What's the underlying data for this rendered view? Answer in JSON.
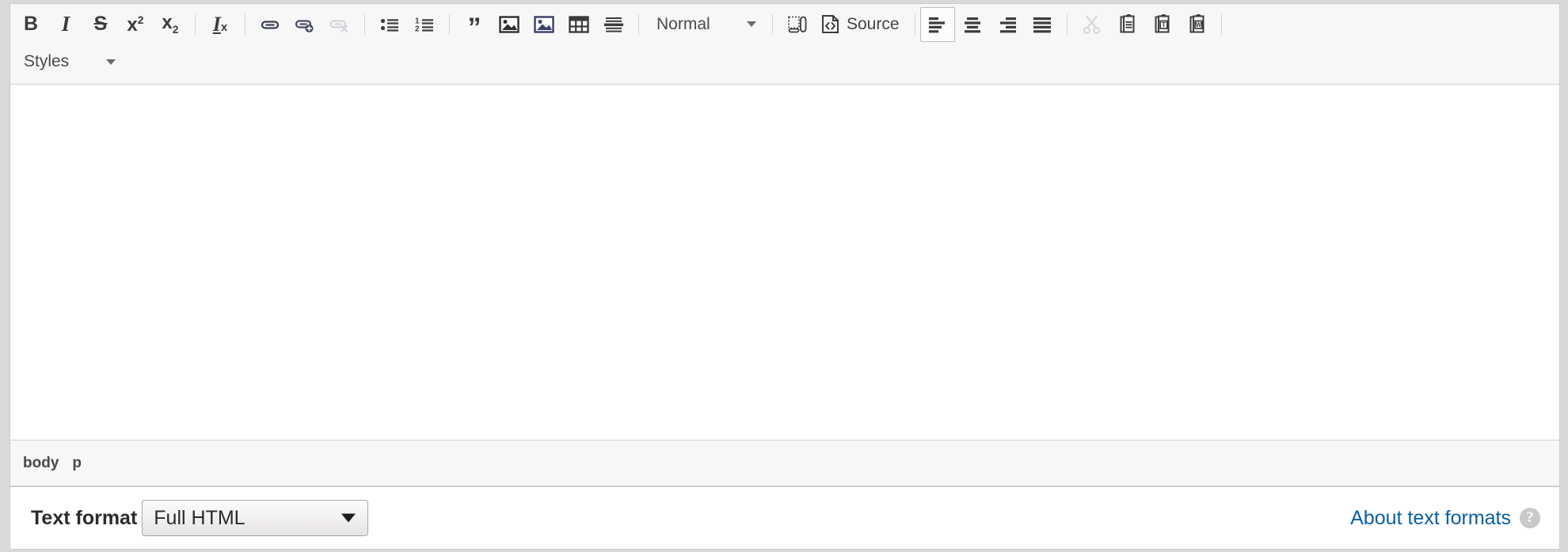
{
  "editor": {
    "name": "ckeditor-rich-text-editor",
    "toolbar": {
      "rows": [
        {
          "groups": [
            {
              "name": "basicstyles",
              "buttons": [
                {
                  "name": "bold-button",
                  "label": "B",
                  "icon": "bold-icon",
                  "title": "Bold",
                  "state": "normal"
                },
                {
                  "name": "italic-button",
                  "label": "I",
                  "icon": "italic-icon",
                  "title": "Italic",
                  "state": "normal"
                },
                {
                  "name": "strikethrough-button",
                  "label": "S",
                  "icon": "strikethrough-icon",
                  "title": "Strike Through",
                  "state": "normal"
                },
                {
                  "name": "superscript-button",
                  "label": "x",
                  "sup": "2",
                  "icon": "superscript-icon",
                  "title": "Superscript",
                  "state": "normal"
                },
                {
                  "name": "subscript-button",
                  "label": "x",
                  "sub": "2",
                  "icon": "subscript-icon",
                  "title": "Subscript",
                  "state": "normal"
                }
              ]
            },
            {
              "name": "removeformat",
              "buttons": [
                {
                  "name": "remove-format-button",
                  "label": "I",
                  "sub": "x",
                  "icon": "remove-format-icon",
                  "title": "Remove Format",
                  "state": "normal"
                }
              ]
            },
            {
              "name": "links",
              "buttons": [
                {
                  "name": "link-button",
                  "icon": "link-icon",
                  "title": "Link",
                  "state": "normal"
                },
                {
                  "name": "anchor-button",
                  "icon": "link-add-icon",
                  "title": "Anchor",
                  "state": "normal"
                },
                {
                  "name": "unlink-button",
                  "icon": "unlink-icon",
                  "title": "Unlink",
                  "state": "disabled"
                }
              ]
            },
            {
              "name": "lists",
              "buttons": [
                {
                  "name": "bulleted-list-button",
                  "icon": "bulleted-list-icon",
                  "title": "Insert/Remove Bulleted List",
                  "state": "normal"
                },
                {
                  "name": "numbered-list-button",
                  "icon": "numbered-list-icon",
                  "title": "Insert/Remove Numbered List",
                  "state": "normal"
                }
              ]
            },
            {
              "name": "insert",
              "buttons": [
                {
                  "name": "blockquote-button",
                  "icon": "blockquote-icon",
                  "title": "Block Quote",
                  "state": "normal"
                },
                {
                  "name": "image-button",
                  "icon": "image-icon",
                  "title": "Image",
                  "state": "normal"
                },
                {
                  "name": "media-button",
                  "icon": "media-image-icon",
                  "title": "Media",
                  "state": "normal"
                },
                {
                  "name": "table-button",
                  "icon": "table-icon",
                  "title": "Table",
                  "state": "normal"
                },
                {
                  "name": "horizontal-rule-button",
                  "icon": "horizontal-rule-icon",
                  "title": "Horizontal Line",
                  "state": "normal"
                }
              ]
            },
            {
              "name": "paragraph-format",
              "combo": {
                "name": "format-combo",
                "value": "Normal",
                "icon": "chevron-down-icon"
              }
            },
            {
              "name": "tools",
              "buttons": [
                {
                  "name": "show-blocks-button",
                  "icon": "show-blocks-icon",
                  "title": "Show Blocks",
                  "state": "normal"
                }
              ],
              "text_buttons": [
                {
                  "name": "source-button",
                  "label": "Source",
                  "icon": "source-code-icon",
                  "title": "Source"
                }
              ]
            },
            {
              "name": "alignment",
              "buttons": [
                {
                  "name": "align-left-button",
                  "icon": "align-left-icon",
                  "title": "Align Left",
                  "state": "active"
                },
                {
                  "name": "align-center-button",
                  "icon": "align-center-icon",
                  "title": "Center",
                  "state": "normal"
                },
                {
                  "name": "align-right-button",
                  "icon": "align-right-icon",
                  "title": "Align Right",
                  "state": "normal"
                },
                {
                  "name": "justify-button",
                  "icon": "justify-icon",
                  "title": "Justify",
                  "state": "normal"
                }
              ]
            },
            {
              "name": "clipboard",
              "buttons": [
                {
                  "name": "cut-button",
                  "icon": "scissors-icon",
                  "title": "Cut",
                  "state": "disabled"
                },
                {
                  "name": "paste-button",
                  "icon": "paste-icon",
                  "title": "Paste",
                  "state": "normal"
                },
                {
                  "name": "paste-as-text-button",
                  "icon": "paste-text-icon",
                  "title": "Paste as plain text",
                  "state": "normal"
                },
                {
                  "name": "paste-from-word-button",
                  "icon": "paste-word-icon",
                  "title": "Paste from Word",
                  "state": "normal"
                }
              ]
            }
          ]
        },
        {
          "groups": [
            {
              "name": "styles",
              "combo": {
                "name": "styles-combo",
                "value": "Styles",
                "icon": "chevron-down-icon"
              }
            }
          ]
        }
      ]
    },
    "content": {
      "name": "editing-area",
      "value": "",
      "placeholder": ""
    },
    "elements_path": {
      "name": "elements-path",
      "items": [
        "body",
        "p"
      ]
    }
  },
  "format_bar": {
    "label": "Text format",
    "select": {
      "name": "text-format-select",
      "value": "Full HTML",
      "options": [
        "Full HTML"
      ]
    },
    "about_link": "About text formats",
    "help_icon_glyph": "?"
  },
  "colors": {
    "toolbar_bg": "#f7f7f7",
    "toolbar_border": "#d1d1d1",
    "frame_border": "#c9cccf",
    "page_bg": "#d9d9d9",
    "editor_bg": "#ffffff",
    "icon": "#3c3c3c",
    "link": "#0b5fa5",
    "help_icon_bg": "#c9c9c9"
  }
}
